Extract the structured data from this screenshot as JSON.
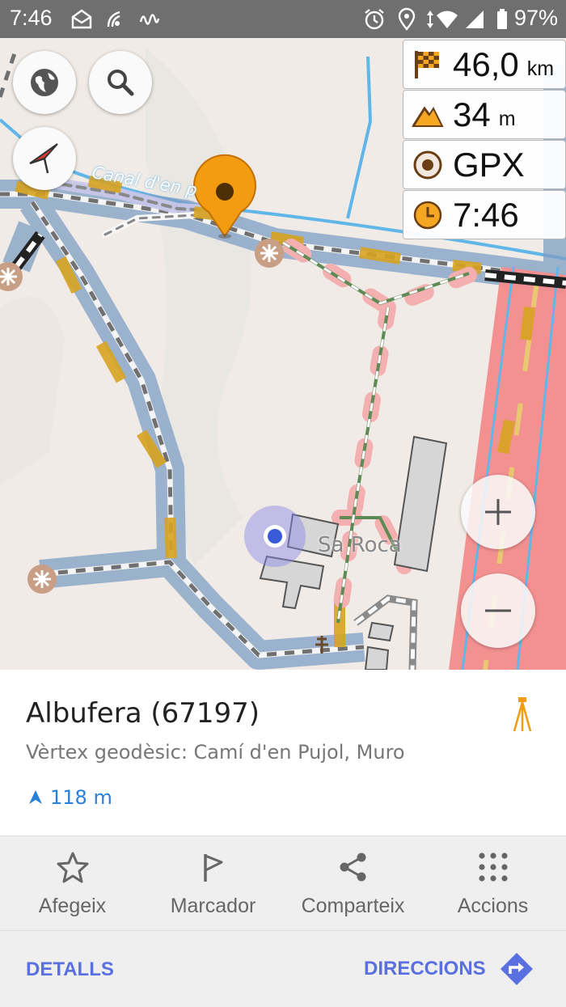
{
  "status_bar": {
    "time": "7:46",
    "battery_percent": "97%",
    "icons": [
      "mail-icon",
      "wifi-calling-icon",
      "signal-wave-icon",
      "alarm-icon",
      "location-icon",
      "data-arrows-icon",
      "wifi-icon",
      "cell-signal-icon",
      "battery-icon"
    ]
  },
  "map": {
    "canal_label": "Canal d'en p",
    "place_label": "Sa Roca",
    "colors": {
      "water": "#60b6e8",
      "track_band": "#7f9fc5",
      "primary_road": "#f28c8c",
      "footpath": "#5e8a55",
      "building": "#d6d6d6"
    }
  },
  "widgets": [
    {
      "icon": "checkered-flag-icon",
      "value": "46,0",
      "unit": "km"
    },
    {
      "icon": "altitude-mountain-icon",
      "value": "34",
      "unit": "m"
    },
    {
      "icon": "gpx-record-icon",
      "value": "GPX",
      "unit": ""
    },
    {
      "icon": "clock-icon",
      "value": "7:46",
      "unit": ""
    }
  ],
  "place_card": {
    "title": "Albufera (67197)",
    "subtitle": "Vèrtex geodèsic: Camí d'en Pujol, Muro",
    "distance": "118 m",
    "type_icon": "tripod-survey-icon"
  },
  "actions": [
    {
      "icon": "star-icon",
      "label": "Afegeix"
    },
    {
      "icon": "flag-icon",
      "label": "Marcador"
    },
    {
      "icon": "share-icon",
      "label": "Comparteix"
    },
    {
      "icon": "dots-grid-icon",
      "label": "Accions"
    }
  ],
  "bottom_bar": {
    "details_label": "DETALLS",
    "directions_label": "DIRECCIONS",
    "accent": "#5a6fe0"
  }
}
